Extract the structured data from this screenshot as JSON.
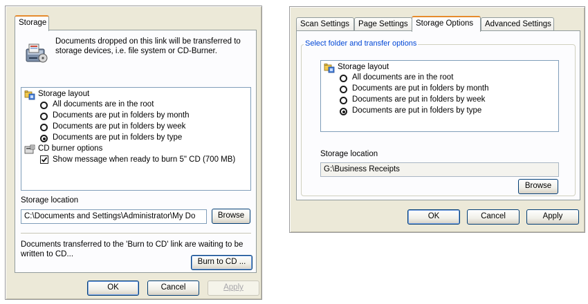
{
  "left_dialog": {
    "tab": "Storage",
    "intro_text": "Documents dropped on this link will be transferred to storage devices, i.e. file system or CD-Burner.",
    "tree": {
      "storage_layout_label": "Storage layout",
      "options": [
        {
          "label": "All documents are in the root",
          "selected": false
        },
        {
          "label": "Documents are put in folders by month",
          "selected": false
        },
        {
          "label": "Documents are put in folders by week",
          "selected": false
        },
        {
          "label": "Documents are put in folders by type",
          "selected": true
        }
      ],
      "cd_burner_label": "CD burner options",
      "cd_checkbox_label": "Show message when ready to burn 5\" CD (700 MB)",
      "cd_checkbox_checked": true
    },
    "storage_location_label": "Storage location",
    "storage_location_value": "C:\\Documents and Settings\\Administrator\\My Do",
    "browse_label": "Browse",
    "burn_message": "Documents transferred to the 'Burn to CD' link are waiting to be written to CD...",
    "burn_button_label": "Burn to CD ...",
    "ok_label": "OK",
    "cancel_label": "Cancel",
    "apply_label": "Apply"
  },
  "right_dialog": {
    "tabs": [
      {
        "label": "Scan Settings",
        "active": false
      },
      {
        "label": "Page Settings",
        "active": false
      },
      {
        "label": "Storage Options",
        "active": true
      },
      {
        "label": "Advanced Settings",
        "active": false
      }
    ],
    "group_title": "Select folder and transfer options",
    "tree": {
      "storage_layout_label": "Storage layout",
      "options": [
        {
          "label": "All documents are in the root",
          "selected": false
        },
        {
          "label": "Documents are put in folders by month",
          "selected": false
        },
        {
          "label": "Documents are put in folders by week",
          "selected": false
        },
        {
          "label": "Documents are put in folders by type",
          "selected": true
        }
      ]
    },
    "storage_location_label": "Storage location",
    "storage_location_value": "G:\\Business Receipts",
    "browse_label": "Browse",
    "ok_label": "OK",
    "cancel_label": "Cancel",
    "apply_label": "Apply"
  }
}
